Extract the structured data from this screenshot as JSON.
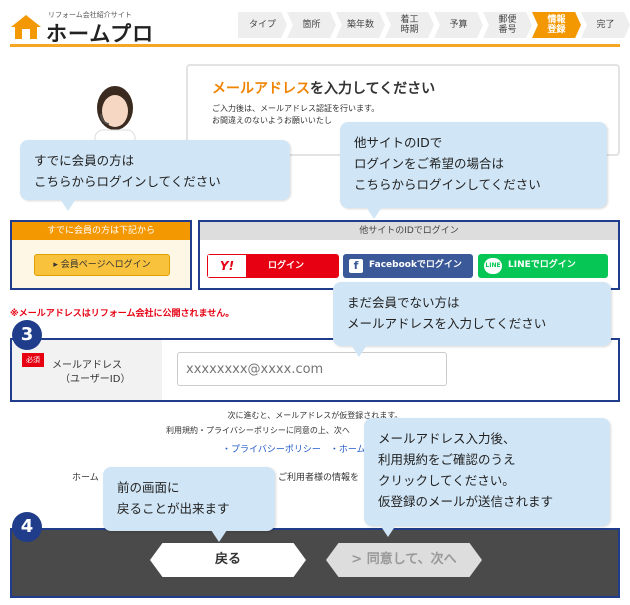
{
  "brand": {
    "tagline": "リフォーム会社紹介サイト",
    "name": "ホームプロ",
    "accent": "#f39800",
    "navy": "#1f3d8a"
  },
  "steps": [
    "タイプ",
    "箇所",
    "築年数",
    "着工\n時期",
    "予算",
    "郵便\n番号",
    "情報\n登録",
    "完了"
  ],
  "active_step_index": 6,
  "message": {
    "title_highlight": "メールアドレス",
    "title_rest": "を入力してください",
    "line1": "ご入力後は、メールアドレス認証を行います。",
    "line2": "お間違えのないようお願いいたし"
  },
  "tips": {
    "t1": "すでに会員の方は\nこちらからログインしてください",
    "t2": "他サイトのIDで\nログインをご希望の場合は\nこちらからログインしてください",
    "t3": "まだ会員でない方は\nメールアドレスを入力してください",
    "t4": "メールアドレス入力後、\n利用規約をご確認のうえ\nクリックしてください。\n仮登録のメールが送信されます",
    "t5": "前の画面に\n戻ることが出来ます"
  },
  "member": {
    "header": "すでに会員の方は下記から",
    "button": "▸ 会員ページへログイン"
  },
  "other": {
    "header": "他サイトのIDでログイン",
    "yahoo_logo": "Y!",
    "yahoo_label": "ログイン",
    "facebook_label": "Facebookでログイン",
    "line_logo": "LINE",
    "line_label": "LINEでログイン"
  },
  "notice": "※メールアドレスはリフォーム会社に公開されません。",
  "badges": {
    "b3": "3",
    "b4": "4"
  },
  "form": {
    "required": "必須",
    "label_line1": "メールアドレス",
    "label_line2": "（ユーザーID）",
    "email_placeholder": "xxxxxxxx@xxxx.com"
  },
  "agreement": {
    "line1": "次に進むと、メールアドレスが仮登録されます。",
    "line2": "利用規約・プライバシーポリシーに同意の上、次へ",
    "links": "・プライバシーポリシー　・ホームプ",
    "info_left": "ホーム",
    "info_right": "ご利用者様の情報を"
  },
  "footer": {
    "back": "戻る",
    "next": "> 同意して、次へ"
  }
}
